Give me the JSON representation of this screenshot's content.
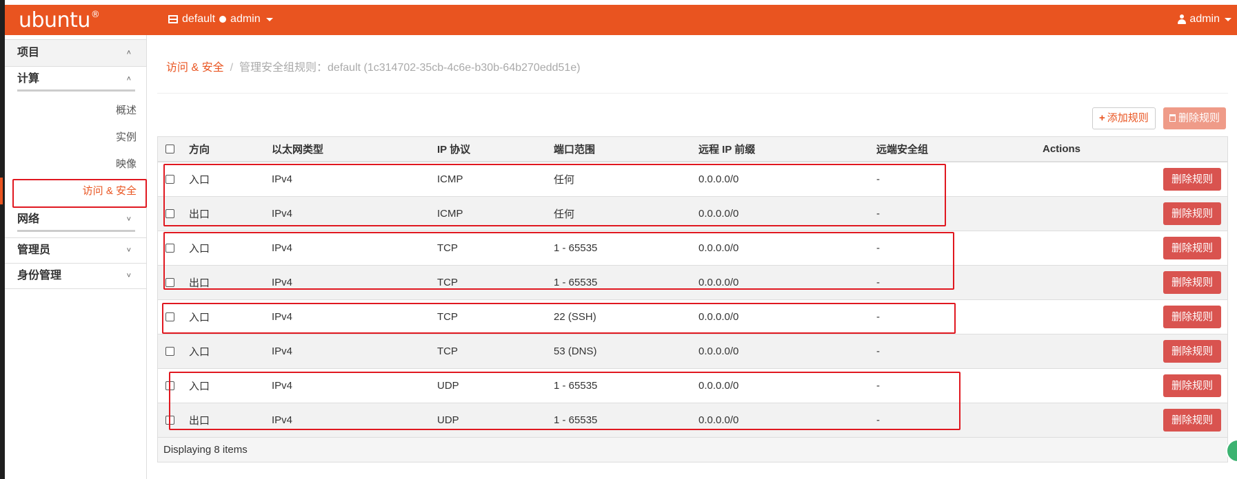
{
  "navbar": {
    "brand": "ubuntu",
    "brand_mark": "®",
    "project_label": "default",
    "project_user": "admin",
    "user_label": "admin"
  },
  "sidebar": {
    "sections": [
      {
        "label": "项目",
        "chevron": "˄"
      },
      {
        "label": "计算",
        "chevron": "˄"
      },
      {
        "label": "网络",
        "chevron": "˅"
      },
      {
        "label": "管理员",
        "chevron": "˅"
      },
      {
        "label": "身份管理",
        "chevron": "˅"
      }
    ],
    "compute_items": [
      "概述",
      "实例",
      "映像",
      "访问 & 安全"
    ]
  },
  "breadcrumb": {
    "link": "访问 & 安全",
    "current": "管理安全组规则：default (1c314702-35cb-4c6e-b30b-64b270edd51e)"
  },
  "toolbar": {
    "add_label": "添加规则",
    "delete_label": "删除规则"
  },
  "table": {
    "headers": [
      "方向",
      "以太网类型",
      "IP 协议",
      "端口范围",
      "远程 IP 前缀",
      "远端安全组",
      "Actions"
    ],
    "rows": [
      {
        "direction": "入口",
        "ethertype": "IPv4",
        "protocol": "ICMP",
        "port": "任何",
        "remote": "0.0.0.0/0",
        "group": "-",
        "action": "删除规则"
      },
      {
        "direction": "出口",
        "ethertype": "IPv4",
        "protocol": "ICMP",
        "port": "任何",
        "remote": "0.0.0.0/0",
        "group": "-",
        "action": "删除规则"
      },
      {
        "direction": "入口",
        "ethertype": "IPv4",
        "protocol": "TCP",
        "port": "1 - 65535",
        "remote": "0.0.0.0/0",
        "group": "-",
        "action": "删除规则"
      },
      {
        "direction": "出口",
        "ethertype": "IPv4",
        "protocol": "TCP",
        "port": "1 - 65535",
        "remote": "0.0.0.0/0",
        "group": "-",
        "action": "删除规则"
      },
      {
        "direction": "入口",
        "ethertype": "IPv4",
        "protocol": "TCP",
        "port": "22 (SSH)",
        "remote": "0.0.0.0/0",
        "group": "-",
        "action": "删除规则"
      },
      {
        "direction": "入口",
        "ethertype": "IPv4",
        "protocol": "TCP",
        "port": "53 (DNS)",
        "remote": "0.0.0.0/0",
        "group": "-",
        "action": "删除规则"
      },
      {
        "direction": "入口",
        "ethertype": "IPv4",
        "protocol": "UDP",
        "port": "1 - 65535",
        "remote": "0.0.0.0/0",
        "group": "-",
        "action": "删除规则"
      },
      {
        "direction": "出口",
        "ethertype": "IPv4",
        "protocol": "UDP",
        "port": "1 - 65535",
        "remote": "0.0.0.0/0",
        "group": "-",
        "action": "删除规则"
      }
    ],
    "footer": "Displaying 8 items"
  },
  "colors": {
    "brand": "#e95420",
    "danger": "#d9534f",
    "highlight": "#e0171f"
  }
}
